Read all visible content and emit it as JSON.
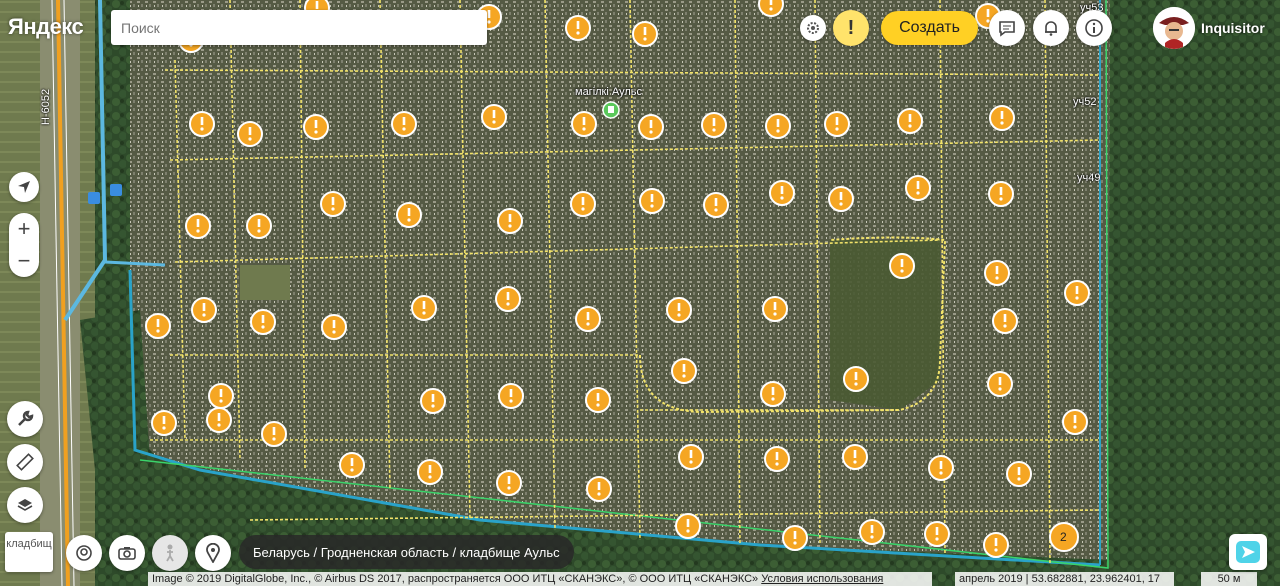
{
  "logo": "Яндекс",
  "search": {
    "placeholder": "Поиск",
    "value": ""
  },
  "toolbar": {
    "create_label": "Создать",
    "alert_label": "!"
  },
  "user": {
    "name": "Inquisitor"
  },
  "zoom": {
    "plus": "+",
    "minus": "−"
  },
  "layer_thumb": "кладбищ",
  "breadcrumb": "Беларусь / Гродненская область / кладбище Аульс",
  "attribution": {
    "text": "Image © 2019 DigitalGlobe, Inc., © Airbus DS 2017, распространяется ООО ИТЦ «СКАНЭКС», © ООО ИТЦ «СКАНЭКС» ",
    "link": "Условия использования"
  },
  "coords": "апрель 2019 | 53.682881, 23.962401, 17",
  "scale": "50 м",
  "map_labels": {
    "cemetery": "магілкі Аульс",
    "road": "Н-6052",
    "plot_53": "уч53",
    "plot_52": "уч52",
    "plot_49": "уч49",
    "cluster_count": "2"
  },
  "icons": [
    "settings-icon",
    "comment-icon",
    "bell-icon",
    "info-icon",
    "locate-icon",
    "wrench-icon",
    "ruler-icon",
    "layers-icon",
    "panorama-icon",
    "camera-icon",
    "pedestrian-icon",
    "pin-icon",
    "next-arrow-icon"
  ],
  "colors": {
    "marker": "#f5a623",
    "accent": "#ffd024",
    "road": "#f0a020",
    "boundary": "#3bd36a"
  }
}
